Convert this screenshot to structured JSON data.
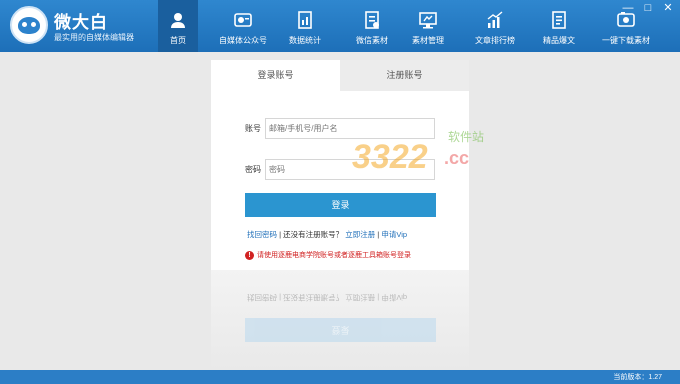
{
  "window": {
    "controls": [
      "—",
      "□",
      "✕"
    ]
  },
  "app": {
    "title": "微大白",
    "subtitle": "最实用的自媒体编辑器"
  },
  "nav": {
    "items": [
      {
        "label": "首页",
        "icon": "home-icon",
        "active": true
      },
      {
        "label": "自媒体公众号",
        "icon": "media-account-icon",
        "active": false
      },
      {
        "label": "数据统计",
        "icon": "statistics-icon",
        "active": false
      },
      {
        "label": "微信素材",
        "icon": "wechat-material-icon",
        "active": false
      },
      {
        "label": "素材管理",
        "icon": "material-manage-icon",
        "active": false
      },
      {
        "label": "文章排行榜",
        "icon": "ranking-icon",
        "active": false
      },
      {
        "label": "精品爆文",
        "icon": "featured-article-icon",
        "active": false
      },
      {
        "label": "一键下载素材",
        "icon": "download-icon",
        "active": false
      }
    ]
  },
  "login": {
    "tab_login": "登录账号",
    "tab_register": "注册账号",
    "account_label": "账号",
    "account_placeholder": "邮箱/手机号/用户名",
    "password_label": "密码",
    "password_placeholder": "密码",
    "submit_label": "登录",
    "forgot_link": "找回密码",
    "no_account_text": " | 还没有注册账号？ ",
    "register_link": "立即注册",
    "separator": " | ",
    "apply_vip_link": "申请Vip",
    "notice": "请使用逐鹿电商学院账号或者逐鹿工具箱账号登录"
  },
  "watermark": {
    "number": "3322",
    "suffix": ".cc",
    "site_text": "软件站"
  },
  "status": {
    "version": "当前版本：1.27"
  },
  "colors": {
    "header": "#2a80c9",
    "nav_active": "#1a5f9e",
    "button": "#2b95d0",
    "notice": "#d12222",
    "link": "#1f6fb9"
  }
}
